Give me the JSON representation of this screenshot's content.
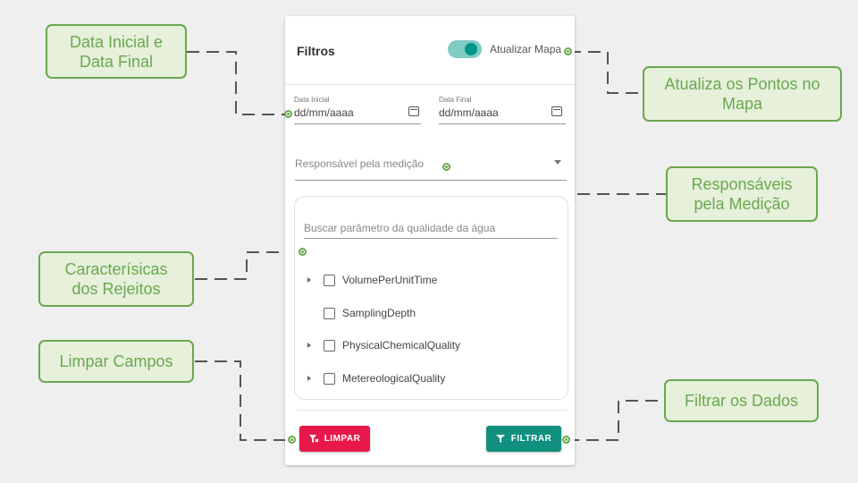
{
  "panel": {
    "title": "Filtros",
    "toggle_label": "Atualizar Mapa",
    "toggle_on": true,
    "date_start": {
      "label": "Data Inicial",
      "value": "dd/mm/aaaa",
      "icon": "calendar-icon"
    },
    "date_end": {
      "label": "Data Final",
      "value": "dd/mm/aaaa",
      "icon": "calendar-icon"
    },
    "responsavel_placeholder": "Responsável pela medição",
    "search_placeholder": "Buscar parâmetro da qualidade da água",
    "tree": [
      {
        "label": "VolumePerUnitTime",
        "expandable": true
      },
      {
        "label": "SamplingDepth",
        "expandable": false
      },
      {
        "label": "PhysicalChemicalQuality",
        "expandable": true
      },
      {
        "label": "MetereologicalQuality",
        "expandable": true
      }
    ],
    "btn_limpar": "LIMPAR",
    "btn_filtrar": "FILTRAR",
    "colors": {
      "accent": "#009688",
      "limpar": "#e8194a",
      "filtrar": "#11907f",
      "callout": "#6aa84f"
    }
  },
  "callouts": {
    "data": "Data Inicial e\nData Final",
    "atualiza": "Atualiza os Pontos no\nMapa",
    "responsaveis": "Responsáveis\npela Medição",
    "caracteristicas": "Caracterísicas\ndos Rejeitos",
    "limpar": "Limpar Campos",
    "filtrar": "Filtrar os Dados"
  }
}
